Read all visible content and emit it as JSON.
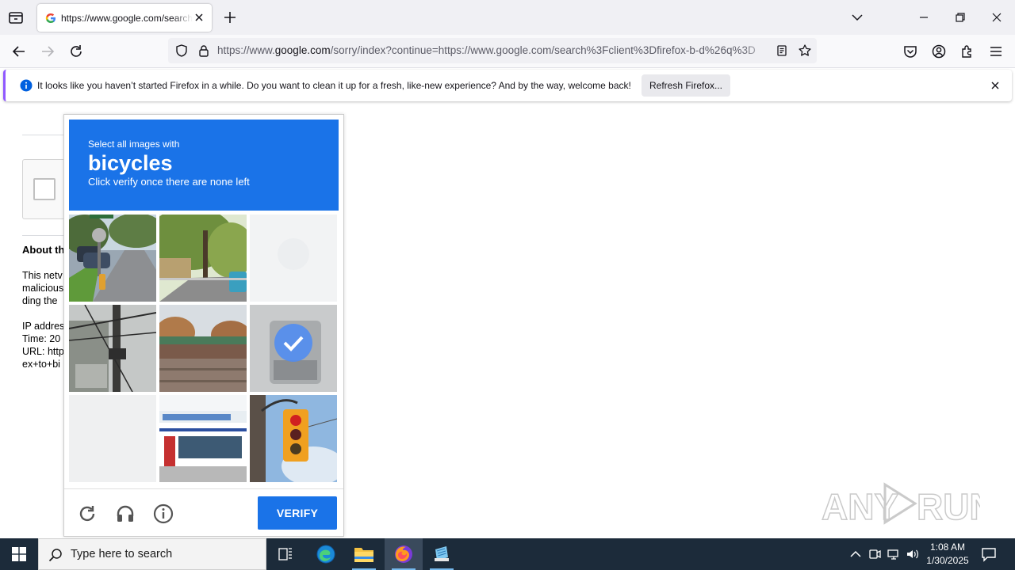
{
  "browser": {
    "tab": {
      "title": "https://www.google.com/search?client=firefox-b-d&q"
    },
    "url": {
      "domain_prefix": "https://www.",
      "domain": "google.com",
      "path": "/sorry/index?continue=https://www.google.com/search%3Fclient%3Dfirefox-b-d%26q%3D"
    }
  },
  "notification": {
    "message": "It looks like you haven’t started Firefox in a while. Do you want to clean it up for a fresh, like-new experience? And by the way, welcome back!",
    "button_label": "Refresh Firefox..."
  },
  "page": {
    "about_heading": "About th",
    "lines": [
      "This netv",
      "malicious",
      "ding the",
      "IP addres",
      "Time: 20",
      "URL: http",
      "ex+to+bi"
    ]
  },
  "captcha": {
    "instruction_line1": "Select all images with",
    "target": "bicycles",
    "instruction_line3": "Click verify once there are none left",
    "verify_label": "VERIFY",
    "tiles": [
      {
        "index": 1,
        "state": "image",
        "subject": "street with cars"
      },
      {
        "index": 2,
        "state": "image",
        "subject": "tree-lined street"
      },
      {
        "index": 3,
        "state": "loading"
      },
      {
        "index": 4,
        "state": "image",
        "subject": "utility pole"
      },
      {
        "index": 5,
        "state": "image",
        "subject": "overpass bridge"
      },
      {
        "index": 6,
        "state": "selected"
      },
      {
        "index": 7,
        "state": "loading"
      },
      {
        "index": 8,
        "state": "image",
        "subject": "storefront"
      },
      {
        "index": 9,
        "state": "image",
        "subject": "traffic light"
      }
    ],
    "colors": {
      "header": "#1a73e8",
      "verify": "#1a73e8"
    }
  },
  "watermark": {
    "text": "ANY RUN"
  },
  "taskbar": {
    "search_placeholder": "Type here to search",
    "time": "1:08 AM",
    "date": "1/30/2025",
    "apps": [
      "task-view",
      "edge",
      "file-explorer",
      "firefox",
      "notepad"
    ]
  }
}
